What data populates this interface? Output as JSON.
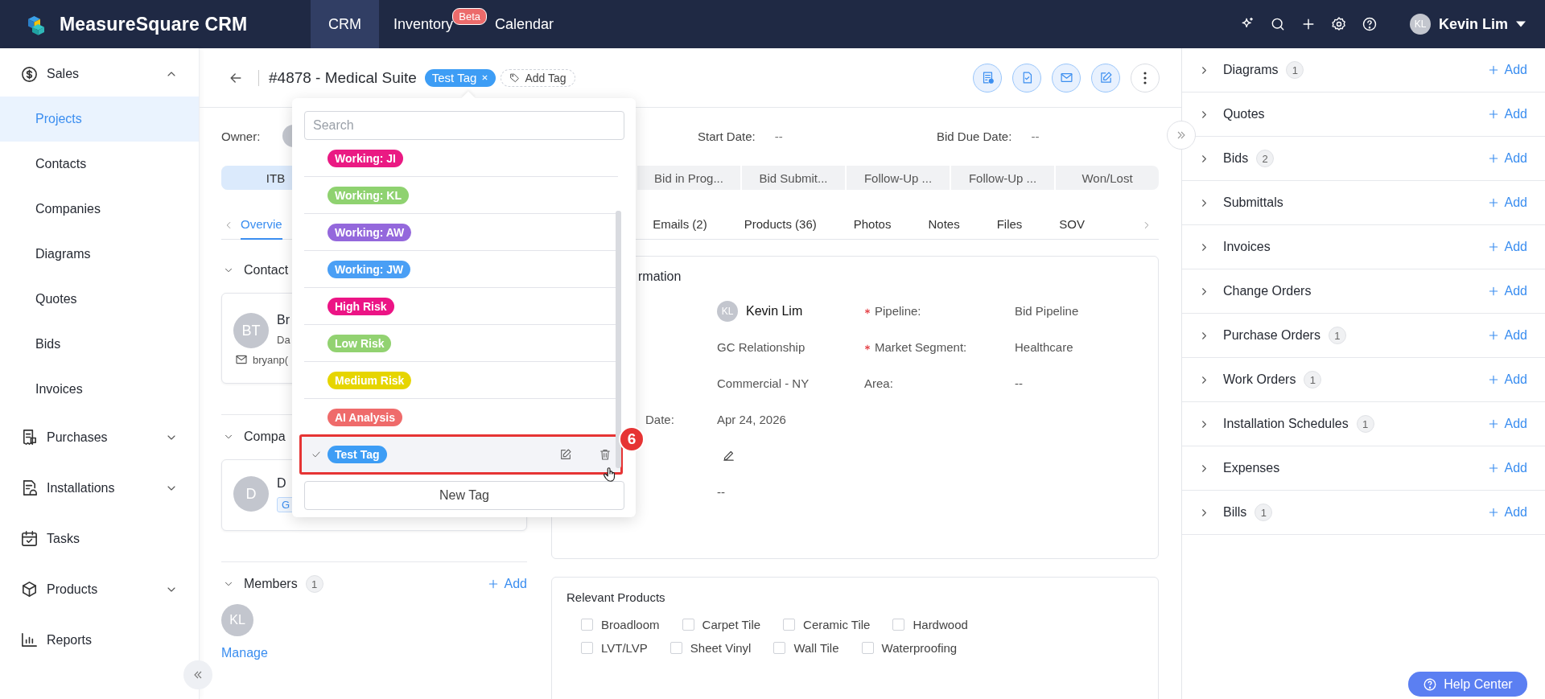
{
  "topbar": {
    "brand": "MeasureSquare CRM",
    "nav": [
      {
        "label": "CRM",
        "selected": true
      },
      {
        "label": "Inventory",
        "selected": false,
        "badge": "Beta"
      },
      {
        "label": "Calendar",
        "selected": false
      }
    ],
    "user": {
      "initials": "KL",
      "name": "Kevin Lim"
    }
  },
  "sidebar": {
    "items": [
      {
        "label": "Sales",
        "kind": "group",
        "expanded": true,
        "children": [
          {
            "label": "Projects",
            "selected": true
          },
          {
            "label": "Contacts",
            "selected": false
          },
          {
            "label": "Companies",
            "selected": false
          },
          {
            "label": "Diagrams",
            "selected": false
          },
          {
            "label": "Quotes",
            "selected": false
          },
          {
            "label": "Bids",
            "selected": false
          },
          {
            "label": "Invoices",
            "selected": false
          }
        ]
      },
      {
        "label": "Purchases",
        "kind": "group",
        "expanded": false
      },
      {
        "label": "Installations",
        "kind": "group",
        "expanded": false
      },
      {
        "label": "Tasks",
        "kind": "link"
      },
      {
        "label": "Products",
        "kind": "group",
        "expanded": false
      },
      {
        "label": "Reports",
        "kind": "link"
      }
    ]
  },
  "project": {
    "title": "#4878 - Medical Suite",
    "tags": [
      {
        "label": "Test Tag",
        "color": "#3d9df5"
      }
    ],
    "add_tag": "Add Tag",
    "owner_label": "Owner:",
    "start_date_label": "Start Date:",
    "start_date": "--",
    "bid_due_label": "Bid Due Date:",
    "bid_due": "--"
  },
  "stages": [
    {
      "label": "ITB",
      "selected": true
    },
    {
      "label": "Bid in Prog...",
      "selected": false
    },
    {
      "label": "Bid Submit...",
      "selected": false
    },
    {
      "label": "Follow-Up ...",
      "selected": false
    },
    {
      "label": "Follow-Up ...",
      "selected": false
    },
    {
      "label": "Won/Lost",
      "selected": false
    }
  ],
  "tabs": [
    {
      "label": "Overvie",
      "selected": true
    },
    {
      "label": "Emails (2)",
      "selected": false
    },
    {
      "label": "Products (36)",
      "selected": false
    },
    {
      "label": "Photos",
      "selected": false
    },
    {
      "label": "Notes",
      "selected": false
    },
    {
      "label": "Files",
      "selected": false
    },
    {
      "label": "SOV",
      "selected": false
    }
  ],
  "contacts_section": {
    "title": "Contact",
    "card": {
      "initials": "BT",
      "name": "Br",
      "company": "Da",
      "email": "bryanp("
    }
  },
  "company_section": {
    "title": "Compa",
    "card": {
      "initials": "D",
      "name": "D",
      "tag": "G"
    }
  },
  "members": {
    "title": "Members",
    "count": "1",
    "add": "Add",
    "avatars": [
      "KL"
    ],
    "manage": "Manage"
  },
  "information": {
    "title": "rmation",
    "left_fields": [
      {
        "kind": "user",
        "initials": "KL",
        "value": "Kevin Lim"
      },
      {
        "kind": "text",
        "value": "GC Relationship"
      },
      {
        "kind": "text",
        "value": "Commercial - NY"
      },
      {
        "kind": "text",
        "label": "Date:",
        "value": "Apr 24, 2026"
      },
      {
        "kind": "edit"
      },
      {
        "kind": "text",
        "value": "--"
      }
    ],
    "right_fields": [
      {
        "label": "Pipeline:",
        "required": true,
        "value": "Bid Pipeline"
      },
      {
        "label": "Market Segment:",
        "required": true,
        "value": "Healthcare"
      },
      {
        "label": "Area:",
        "required": false,
        "value": "--"
      }
    ]
  },
  "products": {
    "title": "Relevant Products",
    "option_rows": [
      {
        "options": [
          {
            "label": "Broadloom",
            "checked": false
          },
          {
            "label": "Carpet Tile",
            "checked": false
          },
          {
            "label": "Ceramic Tile",
            "checked": false
          },
          {
            "label": "Hardwood",
            "checked": false
          }
        ]
      },
      {
        "options": [
          {
            "label": "LVT/LVP",
            "checked": false
          },
          {
            "label": "Sheet Vinyl",
            "checked": false
          },
          {
            "label": "Wall Tile",
            "checked": false
          },
          {
            "label": "Waterproofing",
            "checked": false
          }
        ]
      }
    ]
  },
  "right_panel": {
    "sections": [
      {
        "label": "Diagrams",
        "count": "1",
        "add": "Add"
      },
      {
        "label": "Quotes",
        "add": "Add"
      },
      {
        "label": "Bids",
        "count": "2",
        "add": "Add"
      },
      {
        "label": "Submittals",
        "add": "Add"
      },
      {
        "label": "Invoices",
        "add": "Add"
      },
      {
        "label": "Change Orders",
        "add": "Add"
      },
      {
        "label": "Purchase Orders",
        "count": "1",
        "add": "Add"
      },
      {
        "label": "Work Orders",
        "count": "1",
        "add": "Add"
      },
      {
        "label": "Installation Schedules",
        "count": "1",
        "add": "Add"
      },
      {
        "label": "Expenses",
        "add": "Add"
      },
      {
        "label": "Bills",
        "count": "1",
        "add": "Add"
      }
    ]
  },
  "help_center": "Help Center",
  "tag_menu": {
    "search_placeholder": "Search",
    "new_tag": "New Tag",
    "callout": "6",
    "tags": [
      {
        "label": "Working: JI",
        "color": "#ea1a83",
        "selected": false,
        "highlighted": false
      },
      {
        "label": "Working: KL",
        "color": "#8fd270",
        "selected": false,
        "highlighted": false
      },
      {
        "label": "Working: AW",
        "color": "#9468dc",
        "selected": false,
        "highlighted": false
      },
      {
        "label": "Working: JW",
        "color": "#4a9ff5",
        "selected": false,
        "highlighted": false
      },
      {
        "label": "High Risk",
        "color": "#ec1485",
        "selected": false,
        "highlighted": false
      },
      {
        "label": "Low Risk",
        "color": "#92d271",
        "selected": false,
        "highlighted": false
      },
      {
        "label": "Medium Risk",
        "color": "#e6d500",
        "selected": false,
        "highlighted": false
      },
      {
        "label": "AI Analysis",
        "color": "#ef6b6b",
        "selected": false,
        "highlighted": false
      },
      {
        "label": "Test Tag",
        "color": "#3d9df5",
        "selected": true,
        "highlighted": true
      }
    ]
  }
}
